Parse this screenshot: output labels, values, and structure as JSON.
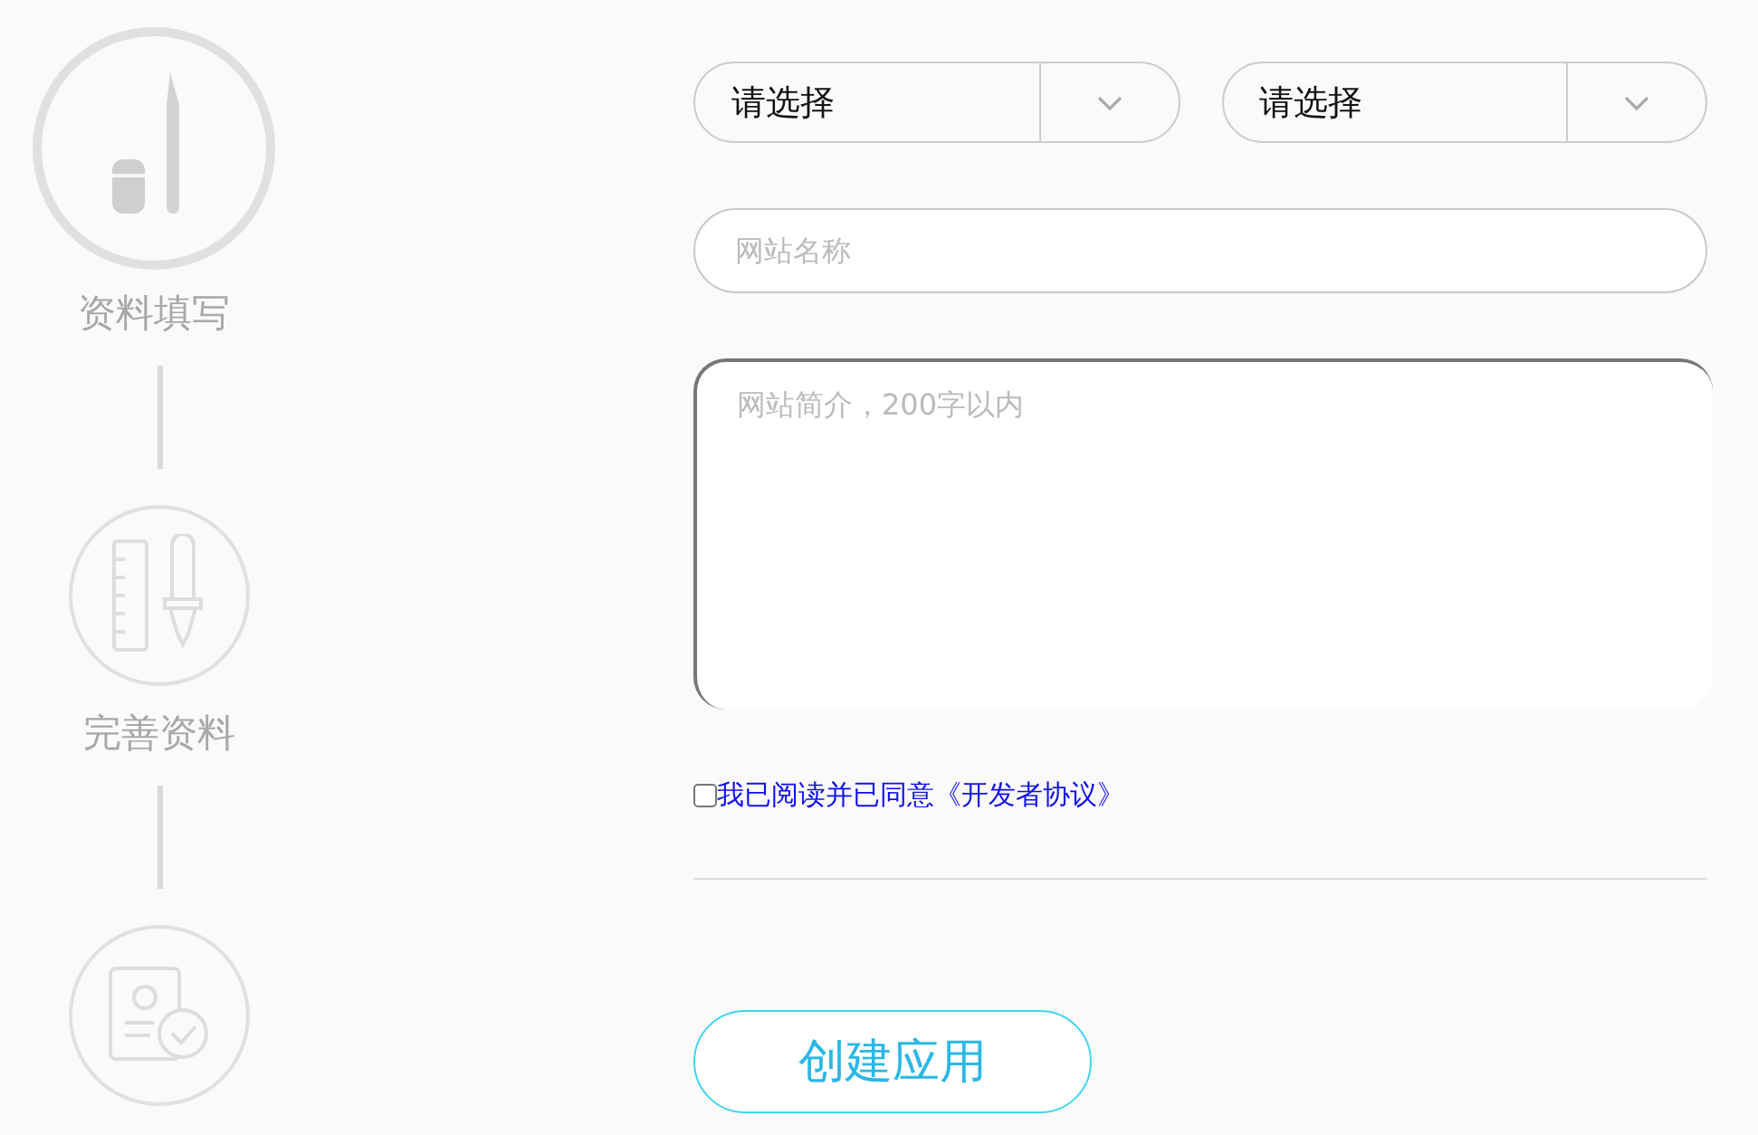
{
  "steps": [
    {
      "kind": "pencil",
      "label": "资料填写",
      "selected": true
    },
    {
      "kind": "ruler",
      "label": "完善资料",
      "selected": false
    },
    {
      "kind": "profile",
      "selected": false
    }
  ],
  "form": {
    "selects": [
      {
        "placeholder": "请选择"
      },
      {
        "placeholder": "请选择"
      }
    ],
    "name_field": {
      "placeholder": "网站名称"
    },
    "intro_field": {
      "placeholder": "网站简介，200字以内"
    },
    "agreement": {
      "checked": false,
      "text": "我已阅读并已同意《开发者协议》"
    },
    "submit": "创建应用"
  }
}
